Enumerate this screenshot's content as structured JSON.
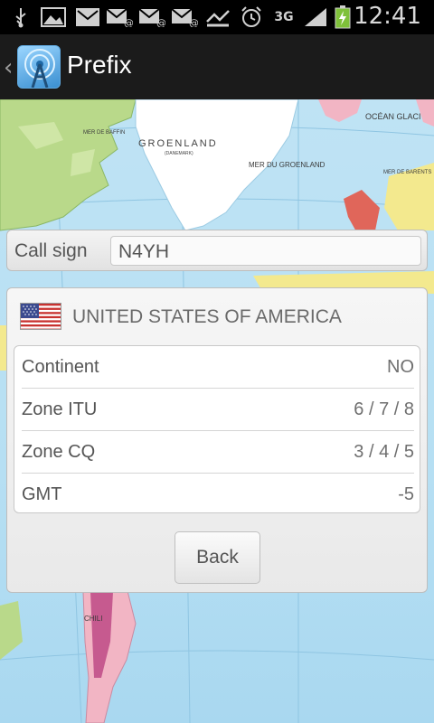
{
  "statusbar": {
    "time": "12:41",
    "network": "3G",
    "icons": [
      "usb-icon",
      "gallery-icon",
      "gmail-icon",
      "email-icon",
      "email-icon",
      "email-icon",
      "missed-call-icon",
      "alarm-icon",
      "network-3g-icon",
      "signal-icon",
      "battery-charging-icon"
    ]
  },
  "actionbar": {
    "back_glyph": "‹",
    "title": "Prefix"
  },
  "map": {
    "labels": {
      "greenland": "GROENLAND",
      "greenland_sub": "(DANEMARK)",
      "baffin": "MER DE BAFFIN",
      "greenland_sea": "MER DU GROENLAND",
      "ocean": "OCÉAN GLACI",
      "barents": "MER DE BARENTS",
      "chili": "CHILI"
    }
  },
  "callsign": {
    "label": "Call sign",
    "value": "N4YH"
  },
  "result": {
    "country": "UNITED STATES OF AMERICA",
    "rows": [
      {
        "label": "Continent",
        "value": "NO"
      },
      {
        "label": "Zone ITU",
        "value": "6 / 7 / 8"
      },
      {
        "label": "Zone CQ",
        "value": "3 / 4 / 5"
      },
      {
        "label": "GMT",
        "value": "-5"
      }
    ],
    "back_label": "Back"
  },
  "colors": {
    "sea": "#b6dff3",
    "land_green": "#b9d98a",
    "land_yellow": "#f3e98e",
    "land_pink": "#f2b5c4",
    "land_red": "#e0665a",
    "greenland": "#ffffff"
  }
}
